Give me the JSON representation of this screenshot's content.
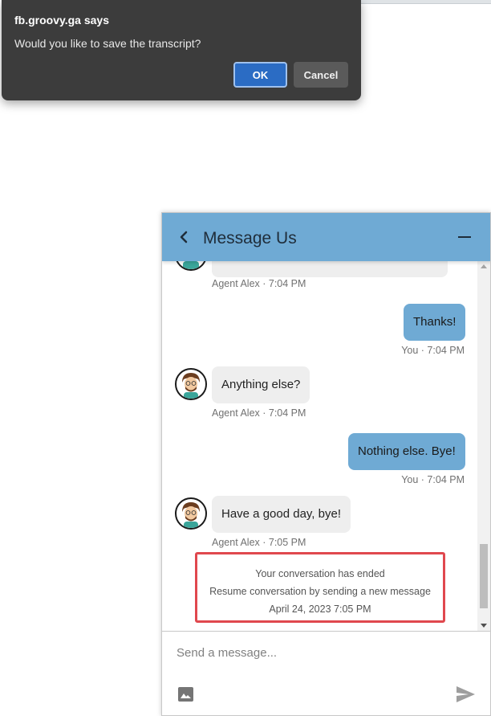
{
  "dialog": {
    "title": "fb.groovy.ga says",
    "message": "Would you like to save the transcript?",
    "ok_label": "OK",
    "cancel_label": "Cancel"
  },
  "chat": {
    "title": "Message Us",
    "icons": {
      "back": "chevron-left-icon",
      "minimize": "minimize-icon",
      "image": "image-icon",
      "send": "send-icon"
    },
    "messages": [
      {
        "sender": "agent",
        "meta": "Agent Alex · 7:04 PM"
      },
      {
        "sender": "user",
        "text": "Thanks!",
        "meta": "You · 7:04 PM"
      },
      {
        "sender": "agent",
        "text": "Anything else?",
        "meta": "Agent Alex · 7:04 PM"
      },
      {
        "sender": "user",
        "text": "Nothing else. Bye!",
        "meta": "You · 7:04 PM"
      },
      {
        "sender": "agent",
        "text": "Have a good day, bye!",
        "meta": "Agent Alex · 7:05 PM"
      }
    ],
    "ended": {
      "line1": "Your conversation has ended",
      "line2": "Resume conversation by sending a new message",
      "date": "April 24, 2023 7:05 PM"
    },
    "composer": {
      "placeholder": "Send a message..."
    }
  },
  "colors": {
    "header": "#6faad4",
    "user_bubble": "#6faad4",
    "agent_bubble": "#eeeeee",
    "highlight_border": "#e0484e",
    "dialog_bg": "#3c3c3c",
    "ok_button": "#2b6cc4"
  }
}
